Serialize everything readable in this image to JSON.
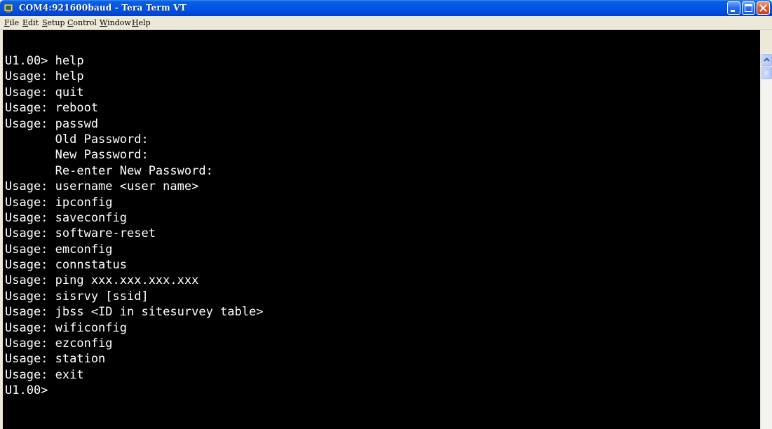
{
  "window": {
    "title": "COM4:921600baud - Tera Term VT"
  },
  "menu": {
    "items": [
      "File",
      "Edit",
      "Setup",
      "Control",
      "Window",
      "Help"
    ]
  },
  "terminal": {
    "lines": [
      "U1.00> help",
      "Usage: help",
      "Usage: quit",
      "Usage: reboot",
      "Usage: passwd",
      "       Old Password:",
      "       New Password:",
      "       Re-enter New Password:",
      "Usage: username <user name>",
      "Usage: ipconfig",
      "Usage: saveconfig",
      "Usage: software-reset",
      "Usage: emconfig",
      "Usage: connstatus",
      "Usage: ping xxx.xxx.xxx.xxx",
      "Usage: sisrvy [ssid]",
      "Usage: jbss <ID in sitesurvey table>",
      "Usage: wificonfig",
      "Usage: ezconfig",
      "Usage: station",
      "Usage: exit",
      "U1.00>"
    ]
  },
  "colors": {
    "terminal_bg": "#000000",
    "terminal_fg": "#ffffff",
    "titlebar": "#0554e6"
  },
  "icons": {
    "app": "tera-term-icon",
    "minimize": "minimize-icon",
    "maximize": "maximize-icon",
    "close": "close-icon",
    "scroll_up": "chevron-up-icon"
  }
}
